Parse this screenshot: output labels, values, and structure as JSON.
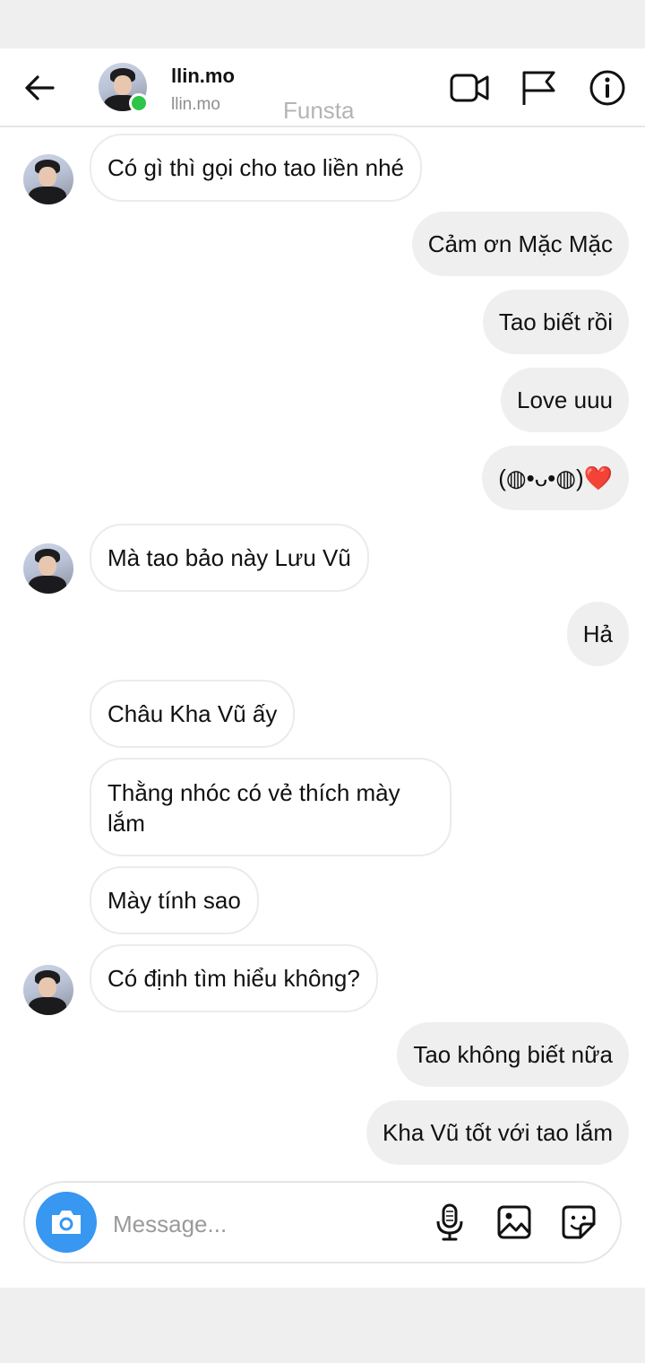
{
  "header": {
    "name": "llin.mo",
    "handle": "llin.mo",
    "watermark": "Funsta"
  },
  "messages": [
    {
      "from": "them",
      "text": "Có gì thì gọi cho tao liền nhé"
    },
    {
      "from": "me",
      "text": "Cảm ơn Mặc Mặc"
    },
    {
      "from": "me",
      "text": "Tao biết rồi"
    },
    {
      "from": "me",
      "text": "Love uuu"
    },
    {
      "from": "me",
      "text": "(◍•ᴗ•◍)❤️"
    },
    {
      "from": "them",
      "text": "Mà tao bảo này Lưu Vũ"
    },
    {
      "from": "me",
      "text": "Hả"
    },
    {
      "from": "them",
      "text": "Châu Kha Vũ ấy"
    },
    {
      "from": "them",
      "text": "Thằng nhóc có vẻ thích mày lắm"
    },
    {
      "from": "them",
      "text": "Mày tính sao"
    },
    {
      "from": "them",
      "text": "Có định tìm hiểu không?"
    },
    {
      "from": "me",
      "text": "Tao không biết nữa"
    },
    {
      "from": "me",
      "text": "Kha Vũ tốt với tao lắm"
    }
  ],
  "composer": {
    "placeholder": "Message..."
  },
  "icons": {
    "back": "arrow-left-icon",
    "video": "video-camera-icon",
    "flag": "flag-icon",
    "info": "info-icon",
    "camera": "camera-icon",
    "mic": "microphone-icon",
    "gallery": "image-icon",
    "sticker": "sticker-icon"
  },
  "colors": {
    "accent": "#3897f0",
    "online": "#2ec44a",
    "outgoing_bubble": "#efefef",
    "incoming_border": "#ebebeb"
  }
}
